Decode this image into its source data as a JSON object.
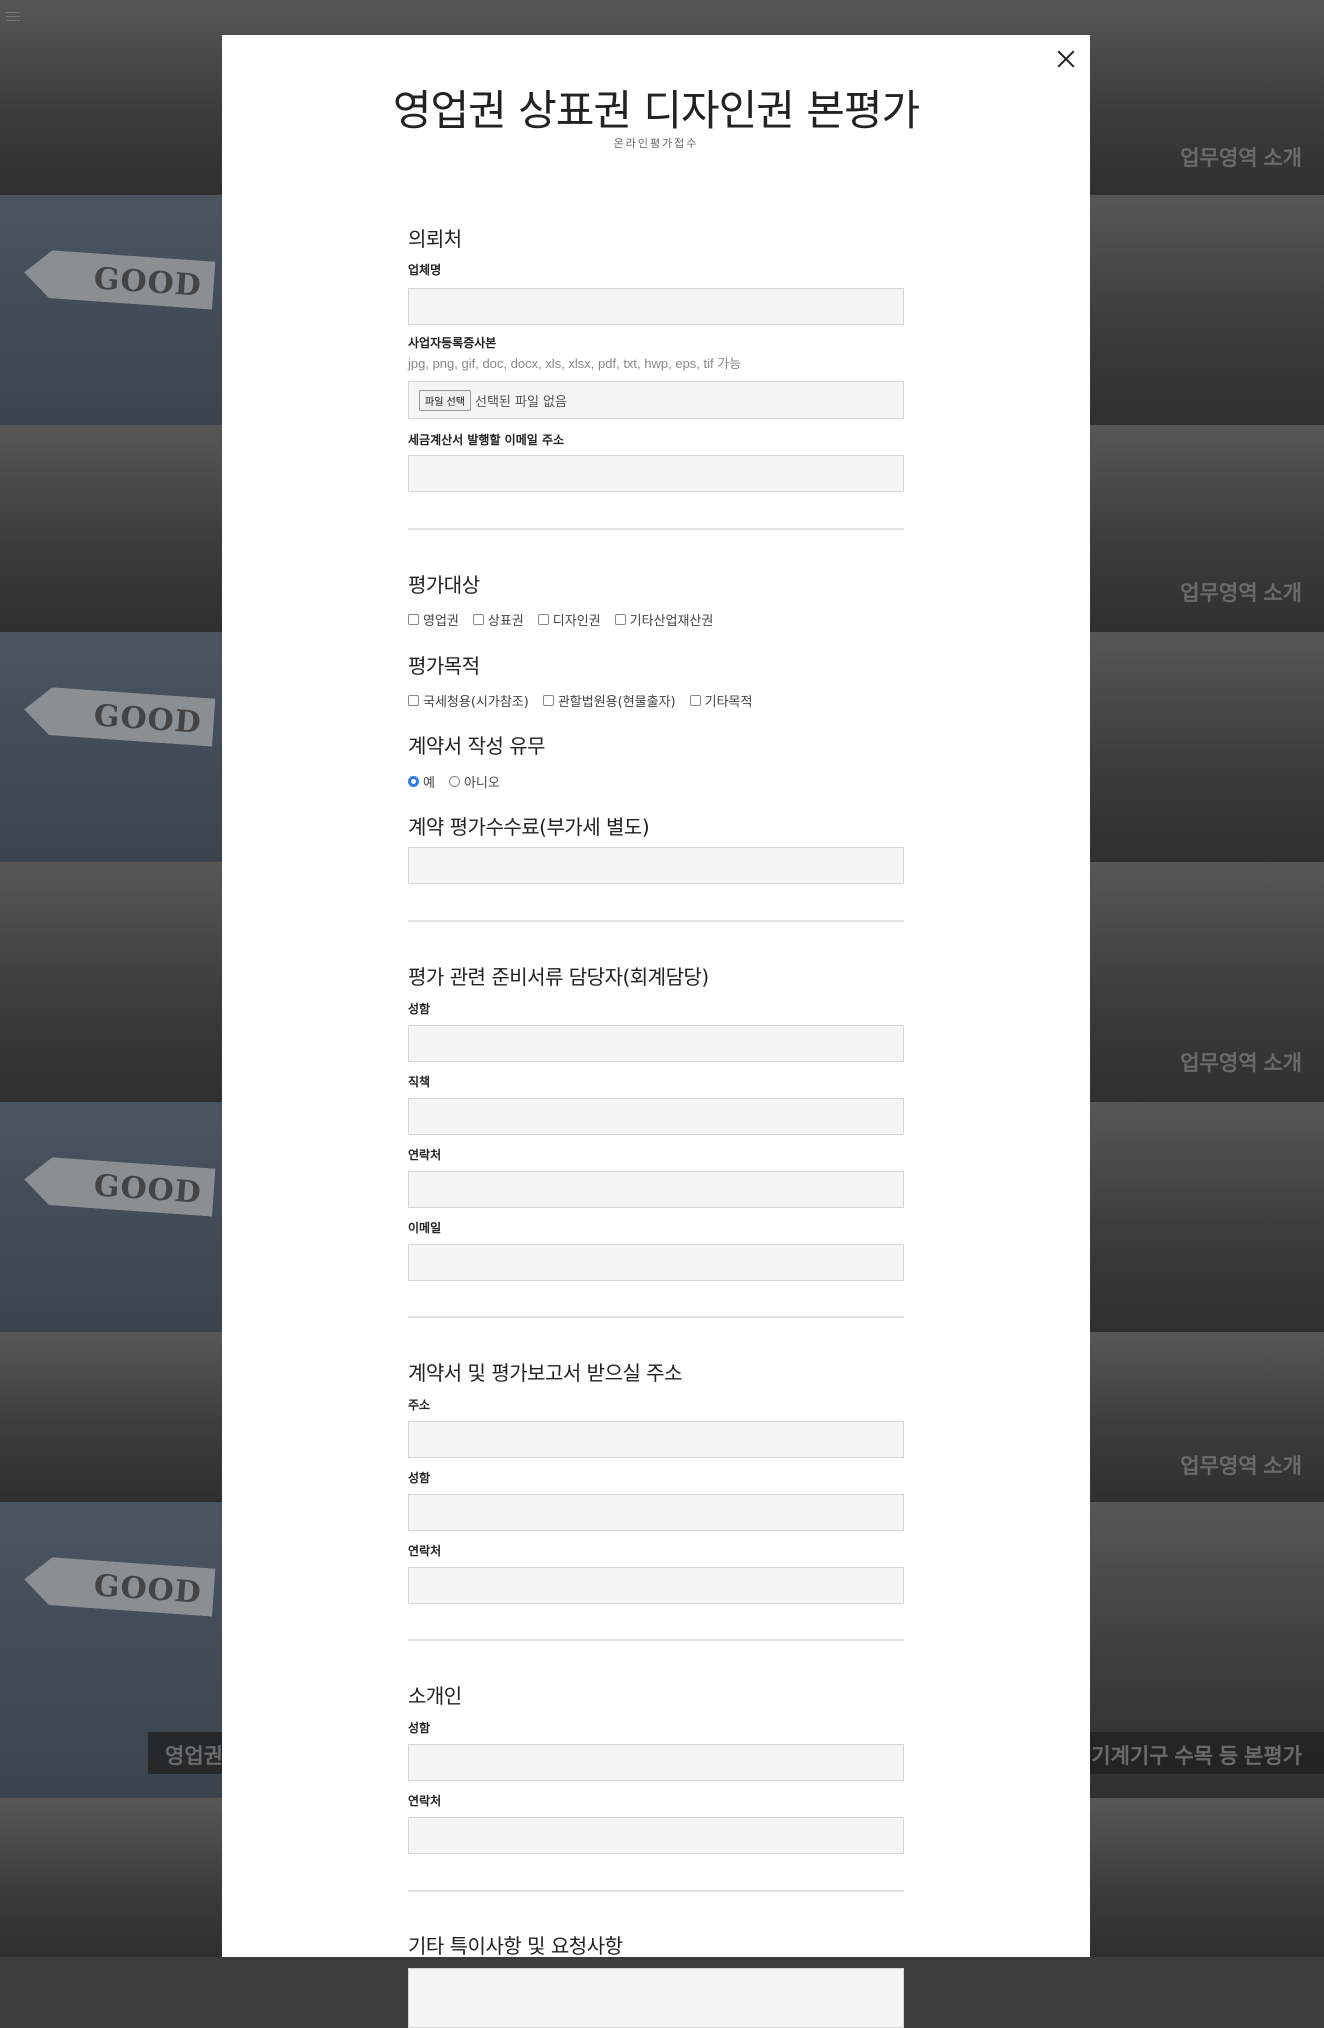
{
  "background": {
    "tiles": {
      "label_right": "업무영역 소개",
      "label_left": "영업권",
      "label_wide": "산 기계기구 수목 등 본평가",
      "sign_text": "GOOD"
    }
  },
  "modal": {
    "title": "영업권 상표권 디자인권 본평가",
    "subtitle": "온라인평가접수",
    "close_icon": "close-icon"
  },
  "client": {
    "heading": "의뢰처",
    "company_label": "업체명",
    "company_value": "",
    "biz_cert_label": "사업자등록증사본",
    "biz_cert_hint": "jpg, png, gif, doc, docx, xls, xlsx, pdf, txt, hwp, eps, tif 가능",
    "file_button": "파일 선택",
    "file_status": "선택된 파일 없음",
    "tax_email_label": "세금계산서 발행할 이메일 주소",
    "tax_email_value": ""
  },
  "target": {
    "heading": "평가대상",
    "options": [
      "영업권",
      "상표권",
      "디자인권",
      "기타산업재산권"
    ]
  },
  "purpose": {
    "heading": "평가목적",
    "options": [
      "국세청용(시가참조)",
      "관할법원용(현물출자)",
      "기타목적"
    ]
  },
  "contract": {
    "heading": "계약서 작성 유무",
    "options": [
      "예",
      "아니오"
    ],
    "selected": "예"
  },
  "fee": {
    "heading": "계약 평가수수료(부가세 별도)",
    "value": ""
  },
  "accounting": {
    "heading": "평가 관련 준비서류 담당자(회계담당)",
    "name_label": "성함",
    "position_label": "직책",
    "phone_label": "연락처",
    "email_label": "이메일"
  },
  "address": {
    "heading": "계약서 및 평가보고서 받으실 주소",
    "address_label": "주소",
    "name_label": "성함",
    "phone_label": "연락처"
  },
  "referrer": {
    "heading": "소개인",
    "name_label": "성함",
    "phone_label": "연락처"
  },
  "notes": {
    "heading": "기타 특이사항 및 요청사항"
  }
}
